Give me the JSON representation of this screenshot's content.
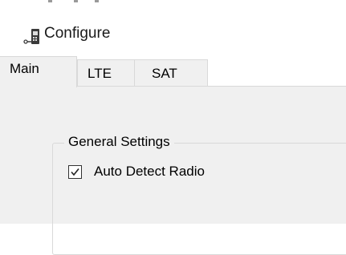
{
  "window": {
    "title": "Configure",
    "icon": "radio-device-icon"
  },
  "tabs": [
    {
      "label": "Main",
      "selected": true
    },
    {
      "label": "LTE",
      "selected": false
    },
    {
      "label": "SAT",
      "selected": false
    }
  ],
  "main_tab": {
    "group_title": "General Settings",
    "auto_detect_radio": {
      "label": "Auto Detect Radio",
      "checked": true
    }
  },
  "colors": {
    "panel": "#f0f0f0",
    "border": "#d9d9d9",
    "text": "#000000"
  }
}
